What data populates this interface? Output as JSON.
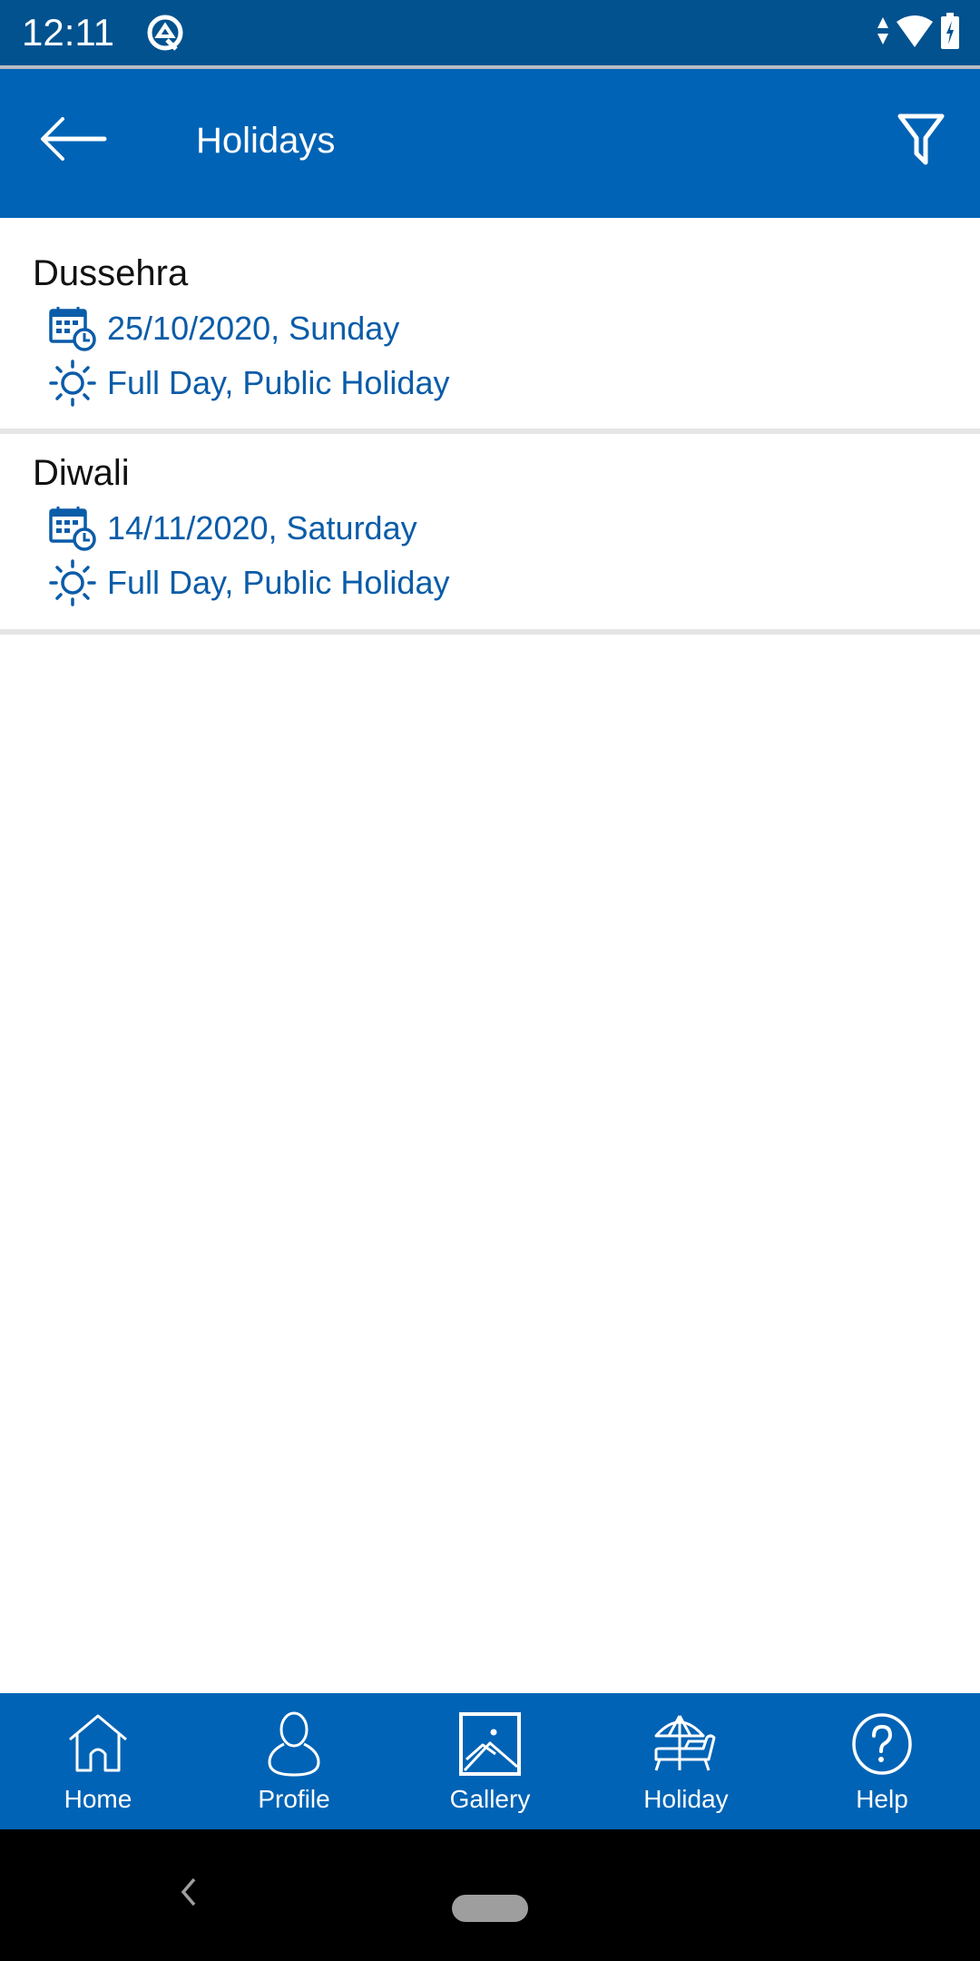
{
  "status_bar": {
    "time": "12:11",
    "icons": [
      "app-notification-icon",
      "data-arrows-icon",
      "wifi-icon",
      "battery-charging-icon"
    ]
  },
  "app_bar": {
    "title": "Holidays",
    "back_icon": "arrow-left-icon",
    "filter_icon": "filter-icon"
  },
  "holidays": [
    {
      "name": "Dussehra",
      "date": "25/10/2020, Sunday",
      "type": "Full Day, Public Holiday"
    },
    {
      "name": "Diwali",
      "date": "14/11/2020, Saturday",
      "type": "Full Day, Public Holiday"
    }
  ],
  "bottom_nav": {
    "items": [
      {
        "label": "Home",
        "icon": "home-icon"
      },
      {
        "label": "Profile",
        "icon": "profile-icon"
      },
      {
        "label": "Gallery",
        "icon": "gallery-icon"
      },
      {
        "label": "Holiday",
        "icon": "beach-chair-icon"
      },
      {
        "label": "Help",
        "icon": "help-icon"
      }
    ]
  },
  "colors": {
    "status_bar": "#02528f",
    "app_bar": "#0063b5",
    "accent_text": "#0a5ca8",
    "separator": "#e5e5e5"
  }
}
